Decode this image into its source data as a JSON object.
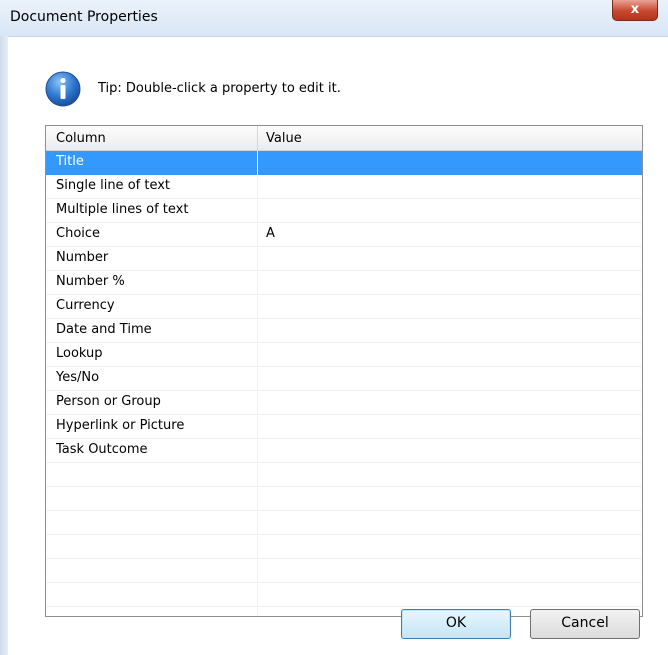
{
  "window": {
    "title": "Document Properties",
    "close_label": "x"
  },
  "tip": {
    "text": "Tip: Double-click a property to edit it."
  },
  "table": {
    "headers": [
      "Column",
      "Value"
    ],
    "rows": [
      {
        "column": "Title",
        "value": ""
      },
      {
        "column": "Single line of text",
        "value": ""
      },
      {
        "column": "Multiple lines of text",
        "value": ""
      },
      {
        "column": "Choice",
        "value": "A"
      },
      {
        "column": "Number",
        "value": ""
      },
      {
        "column": "Number %",
        "value": ""
      },
      {
        "column": "Currency",
        "value": ""
      },
      {
        "column": "Date and Time",
        "value": ""
      },
      {
        "column": "Lookup",
        "value": ""
      },
      {
        "column": "Yes/No",
        "value": ""
      },
      {
        "column": "Person or Group",
        "value": ""
      },
      {
        "column": "Hyperlink or Picture",
        "value": ""
      },
      {
        "column": "Task Outcome",
        "value": ""
      }
    ],
    "selected_index": 0
  },
  "buttons": {
    "ok": "OK",
    "cancel": "Cancel"
  },
  "colors": {
    "selection": "#3399ff",
    "title_bar": "#dbe6f4",
    "close": "#c8472f"
  }
}
